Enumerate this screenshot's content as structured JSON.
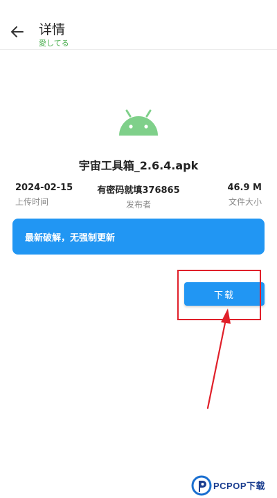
{
  "header": {
    "back_icon": "arrow-left-icon",
    "title": "详情",
    "subtitle": "愛してる"
  },
  "app": {
    "icon": "android-icon",
    "icon_color": "#7fd08a",
    "file_name": "宇宙工具箱_2.6.4.apk"
  },
  "meta": {
    "date_value": "2024-02-15",
    "date_label": "上传时间",
    "publisher_value": "有密码就填376865",
    "publisher_label": "发布者",
    "size_value": "46.9 M",
    "size_label": "文件大小"
  },
  "notice": {
    "text": "最新破解，无强制更新"
  },
  "actions": {
    "download_label": "下载"
  },
  "watermark": {
    "text": "PCPOP下载"
  },
  "colors": {
    "accent": "#2196f3",
    "subtitle": "#4caf50",
    "annotation": "#e0202a"
  }
}
